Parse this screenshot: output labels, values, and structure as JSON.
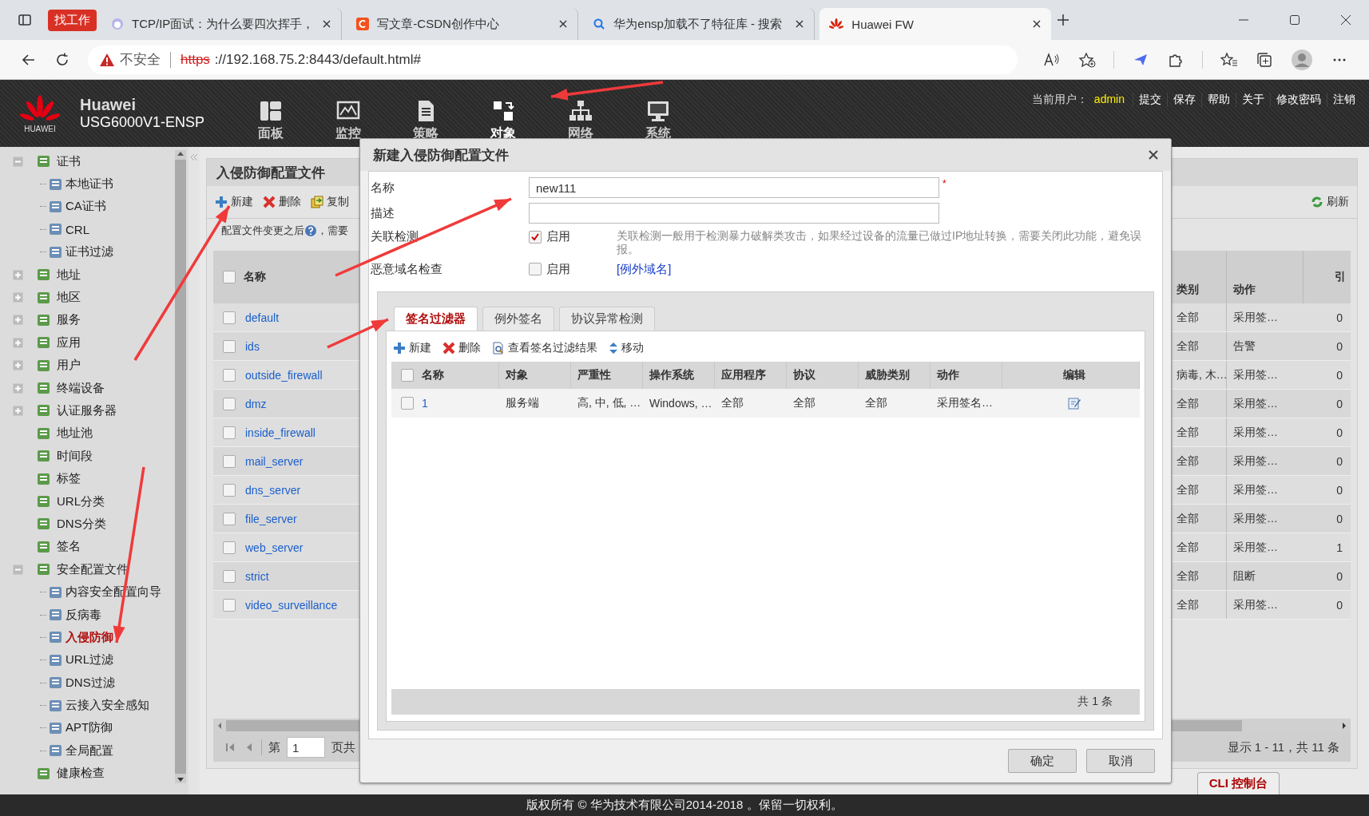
{
  "browser": {
    "tab_group": "找工作",
    "tabs": [
      {
        "title": "TCP/IP面试：为什么要四次挥手，",
        "kind": "avatar",
        "selected": false
      },
      {
        "title": "写文章-CSDN创作中心",
        "kind": "orange",
        "selected": false
      },
      {
        "title": "华为ensp加载不了特征库 - 搜索",
        "kind": "search",
        "selected": false
      },
      {
        "title": "Huawei FW",
        "kind": "flower",
        "selected": true
      }
    ],
    "address": {
      "security": "不安全",
      "scheme": "https",
      "rest": "://192.168.75.2:8443/default.html#"
    }
  },
  "header": {
    "brand": "Huawei",
    "logo_caption": "HUAWEI",
    "model": "USG6000V1-ENSP",
    "nav": [
      {
        "label": "面板",
        "kind": "dashboard",
        "selected": false
      },
      {
        "label": "监控",
        "kind": "monitor",
        "selected": false
      },
      {
        "label": "策略",
        "kind": "policy",
        "selected": false
      },
      {
        "label": "对象",
        "kind": "object",
        "selected": true
      },
      {
        "label": "网络",
        "kind": "network",
        "selected": false
      },
      {
        "label": "系统",
        "kind": "system",
        "selected": false
      }
    ],
    "user_label": "当前用户：",
    "user": "admin",
    "links": [
      "提交",
      "保存",
      "帮助",
      "关于",
      "修改密码",
      "注销"
    ]
  },
  "sidebar": {
    "items": [
      {
        "label": "证书",
        "expanded": true,
        "selected": false,
        "children": [
          {
            "label": "本地证书",
            "selected": false
          },
          {
            "label": "CA证书",
            "selected": false
          },
          {
            "label": "CRL",
            "selected": false
          },
          {
            "label": "证书过滤",
            "selected": false
          }
        ]
      },
      {
        "label": "地址",
        "expanded": false,
        "selected": false
      },
      {
        "label": "地区",
        "expanded": false,
        "selected": false
      },
      {
        "label": "服务",
        "expanded": false,
        "selected": false
      },
      {
        "label": "应用",
        "expanded": false,
        "selected": false
      },
      {
        "label": "用户",
        "expanded": false,
        "selected": false
      },
      {
        "label": "终端设备",
        "expanded": false,
        "selected": false
      },
      {
        "label": "认证服务器",
        "expanded": false,
        "selected": false
      },
      {
        "label": "地址池",
        "selected": false
      },
      {
        "label": "时间段",
        "selected": false
      },
      {
        "label": "标签",
        "selected": false
      },
      {
        "label": "URL分类",
        "selected": false
      },
      {
        "label": "DNS分类",
        "selected": false
      },
      {
        "label": "签名",
        "selected": false
      },
      {
        "label": "安全配置文件",
        "expanded": true,
        "selected": false,
        "children": [
          {
            "label": "内容安全配置向导",
            "selected": false
          },
          {
            "label": "反病毒",
            "selected": false
          },
          {
            "label": "入侵防御",
            "selected": true
          },
          {
            "label": "URL过滤",
            "selected": false
          },
          {
            "label": "DNS过滤",
            "selected": false
          },
          {
            "label": "云接入安全感知",
            "selected": false
          },
          {
            "label": "APT防御",
            "selected": false
          },
          {
            "label": "全局配置",
            "selected": false
          }
        ]
      },
      {
        "label": "健康检查",
        "selected": false
      }
    ]
  },
  "main": {
    "title": "入侵防御配置文件",
    "toolbar": [
      {
        "kind": "add",
        "label": "新建"
      },
      {
        "kind": "delete",
        "label": "删除"
      },
      {
        "kind": "copy",
        "label": "复制"
      }
    ],
    "refresh": "刷新",
    "note": "配置文件变更之后",
    "note_tail": "，需要",
    "table": {
      "all_checked": false,
      "columns": [
        "名称",
        "类别",
        "动作",
        "引"
      ],
      "rows": [
        {
          "name": "default",
          "type": "全部",
          "action": "采用签…",
          "refs": "0",
          "checked": false
        },
        {
          "name": "ids",
          "type": "全部",
          "action": "告警",
          "refs": "0",
          "checked": false
        },
        {
          "name": "outside_firewall",
          "type": "病毒, 木…",
          "action": "采用签…",
          "refs": "0",
          "checked": false
        },
        {
          "name": "dmz",
          "type": "全部",
          "action": "采用签…",
          "refs": "0",
          "checked": false
        },
        {
          "name": "inside_firewall",
          "type": "全部",
          "action": "采用签…",
          "refs": "0",
          "checked": false
        },
        {
          "name": "mail_server",
          "type": "全部",
          "action": "采用签…",
          "refs": "0",
          "checked": false
        },
        {
          "name": "dns_server",
          "type": "全部",
          "action": "采用签…",
          "refs": "0",
          "checked": false
        },
        {
          "name": "file_server",
          "type": "全部",
          "action": "采用签…",
          "refs": "0",
          "checked": false
        },
        {
          "name": "web_server",
          "type": "全部",
          "action": "采用签…",
          "refs": "1",
          "checked": false
        },
        {
          "name": "strict",
          "type": "全部",
          "action": "阻断",
          "refs": "0",
          "checked": false
        },
        {
          "name": "video_surveillance",
          "type": "全部",
          "action": "采用签…",
          "refs": "0",
          "checked": false
        }
      ]
    },
    "pager": {
      "page_label": "第",
      "page": "1",
      "page_suffix": "页共",
      "summary": "显示 1 - 11，共 11 条"
    }
  },
  "dialog": {
    "title": "新建入侵防御配置文件",
    "name": {
      "label": "名称",
      "value": "new111",
      "required_mark": "*"
    },
    "description": {
      "label": "描述"
    },
    "correlation": {
      "label": "关联检测",
      "option": "启用",
      "checked": true,
      "hint": "关联检测一般用于检测暴力破解类攻击，如果经过设备的流量已做过IP地址转换，需要关闭此功能，避免误报。"
    },
    "malicious_domain": {
      "label": "恶意域名检查",
      "option": "启用",
      "checked": false,
      "link": "[例外域名]"
    },
    "tabs": [
      {
        "label": "签名过滤器",
        "selected": true
      },
      {
        "label": "例外签名",
        "selected": false
      },
      {
        "label": "协议异常检测",
        "selected": false
      }
    ],
    "toolbar": [
      {
        "kind": "add",
        "label": "新建"
      },
      {
        "kind": "delete",
        "label": "删除"
      },
      {
        "kind": "view",
        "label": "查看签名过滤结果"
      },
      {
        "kind": "move",
        "label": "移动"
      }
    ],
    "table": {
      "all_checked": false,
      "columns": [
        "名称",
        "对象",
        "严重性",
        "操作系统",
        "应用程序",
        "协议",
        "威胁类别",
        "动作",
        "编辑"
      ],
      "rows": [
        {
          "checked": false,
          "cells": [
            "1",
            "服务端",
            "高, 中, 低, …",
            "Windows, …",
            "全部",
            "全部",
            "全部",
            "采用签名…"
          ]
        }
      ]
    },
    "total": "共 1 条",
    "buttons": [
      "确定",
      "取消"
    ]
  },
  "cli_tab": "CLI 控制台",
  "footer": "版权所有 © 华为技术有限公司2014-2018 。保留一切权利。"
}
